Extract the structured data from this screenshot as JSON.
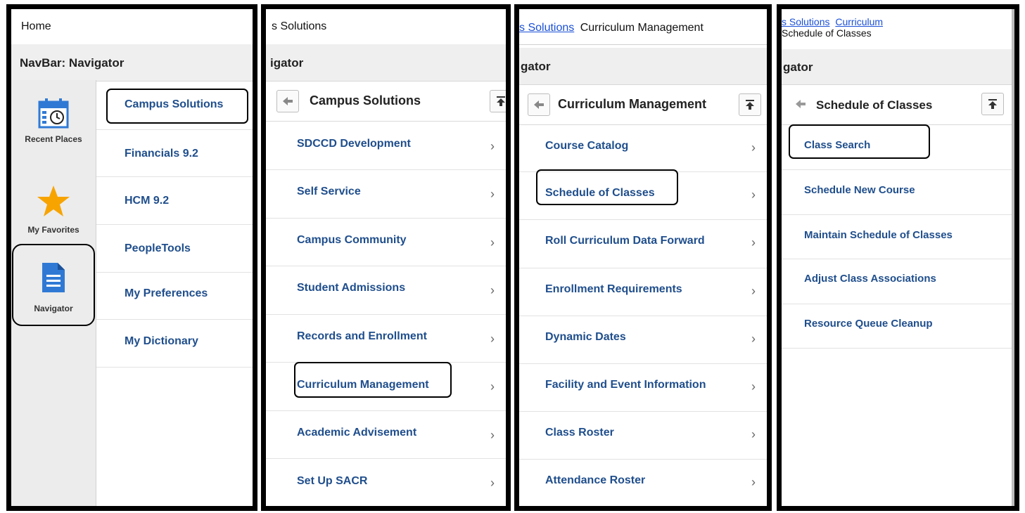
{
  "panel1": {
    "header": "Home",
    "title": "NavBar: Navigator",
    "sidebar": [
      {
        "label": "Recent Places",
        "icon": "calendar-clock-icon"
      },
      {
        "label": "My Favorites",
        "icon": "star-icon"
      },
      {
        "label": "Navigator",
        "icon": "document-icon"
      }
    ],
    "items": [
      "Campus Solutions",
      "Financials 9.2",
      "HCM 9.2",
      "PeopleTools",
      "My Preferences",
      "My Dictionary"
    ]
  },
  "panel2": {
    "header": "s Solutions",
    "title": "igator",
    "subtitle": "Campus Solutions",
    "items": [
      "SDCCD Development",
      "Self Service",
      "Campus Community",
      "Student Admissions",
      "Records and Enrollment",
      "Curriculum Management",
      "Academic Advisement",
      "Set Up SACR"
    ]
  },
  "panel3": {
    "header_link": "s Solutions",
    "header_text": "Curriculum Management",
    "title": "gator",
    "subtitle": "Curriculum Management",
    "items": [
      "Course Catalog",
      "Schedule of Classes",
      "Roll Curriculum Data Forward",
      "Enrollment Requirements",
      "Dynamic Dates",
      "Facility and Event Information",
      "Class Roster",
      "Attendance Roster"
    ]
  },
  "panel4": {
    "header_link1": "s Solutions",
    "header_link2": "Curriculum",
    "header_line2": "Schedule of Classes",
    "title": "gator",
    "subtitle": "Schedule of Classes",
    "items": [
      "Class Search",
      "Schedule New Course",
      "Maintain Schedule of Classes",
      "Adjust Class Associations",
      "Resource Queue Cleanup"
    ]
  },
  "colors": {
    "link": "#1f4e8c",
    "star": "#f7a400",
    "nav_icon": "#2f79d4"
  }
}
